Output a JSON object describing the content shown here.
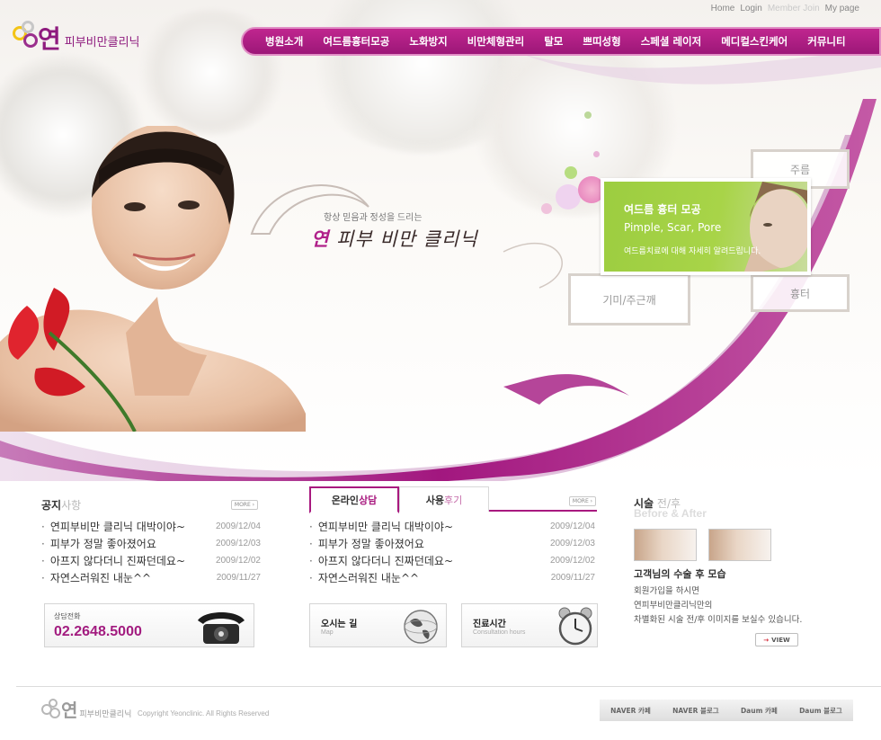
{
  "top_links": [
    "Home",
    "Login",
    "Member Join",
    "My page"
  ],
  "logo": {
    "word": "연",
    "sub": "피부비만클리닉"
  },
  "nav": [
    "병원소개",
    "여드름흉터모공",
    "노화방지",
    "비만체형관리",
    "탈모",
    "쁘띠성형",
    "스페셜 레이저",
    "메디컬스킨케어",
    "커뮤니티"
  ],
  "hero": {
    "tagline": "항상 믿음과 정성을 드리는",
    "brand_accent": "연",
    "brand_rest": " 피부 비만 클리닉",
    "tiles": {
      "wrinkle": "주름",
      "scar": "흉터",
      "melasma": "기미/주근깨"
    },
    "feature": {
      "title": "여드름 흉터 모공",
      "subtitle": "Pimple, Scar, Pore",
      "desc": "여드름치료에 대해 자세히 알려드립니다."
    }
  },
  "notice": {
    "title_a": "공지",
    "title_b": "사항",
    "more": "MORE",
    "items": [
      {
        "title": "연피부비만 클리닉 대박이야~",
        "date": "2009/12/04"
      },
      {
        "title": "피부가 정말 좋아졌어요",
        "date": "2009/12/03"
      },
      {
        "title": "아프지 않다더니 진짜던데요~",
        "date": "2009/12/02"
      },
      {
        "title": "자연스러워진 내눈^^",
        "date": "2009/11/27"
      }
    ]
  },
  "consult": {
    "tab1_a": "온라인",
    "tab1_b": "상담",
    "tab2_a": "사용",
    "tab2_b": "후기",
    "more": "MORE",
    "items": [
      {
        "title": "연피부비만 클리닉 대박이야~",
        "date": "2009/12/04"
      },
      {
        "title": "피부가 정말 좋아졌어요",
        "date": "2009/12/03"
      },
      {
        "title": "아프지 않다더니 진짜던데요~",
        "date": "2009/12/02"
      },
      {
        "title": "자연스러워진 내눈^^",
        "date": "2009/11/27"
      }
    ]
  },
  "phone_box": {
    "label": "상담전화",
    "number": "02.2648.5000"
  },
  "map_box": {
    "label": "오시는 길",
    "en": "Map"
  },
  "hours_box": {
    "label": "진료시간",
    "en": "Consultation hours"
  },
  "before_after": {
    "title_a": "시술",
    "title_b": " 전/후",
    "sub": "Before & After",
    "heading": "고객님의 수술 후 모습",
    "desc": [
      "회원가입을 하시면",
      "연피부비만클리닉만의",
      "차별화된 시술 전/후 이미지를 보실수 있습니다."
    ],
    "view": "VIEW"
  },
  "footer": {
    "copyright": "Copyright Yeonclinic. All Rights Reserved",
    "links": [
      "NAVER 카페",
      "NAVER 블로그",
      "Daum 카페",
      "Daum 블로그"
    ]
  },
  "colors": {
    "brand": "#a21b7f",
    "nav": "#b02088",
    "feature": "#a2d044"
  }
}
